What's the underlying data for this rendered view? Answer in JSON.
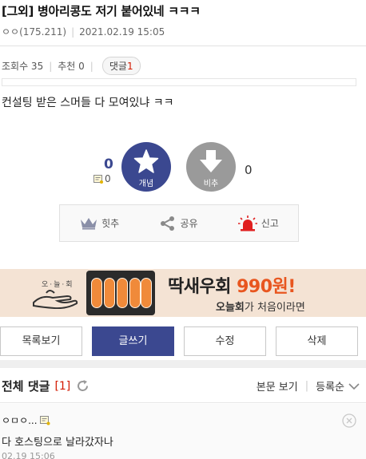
{
  "post": {
    "title": "[그외] 병아리콩도 저기 붙어있네 ㅋㅋㅋ",
    "author": "ㅇㅇ(175.211)",
    "date": "2021.02.19 15:05",
    "views_label": "조회수 35",
    "recommend_label": "추천 0",
    "comment_label": "댓글",
    "comment_count": "1",
    "body": "컨설팅 받은 스머들 다 모여있냐 ㅋㅋ"
  },
  "vote": {
    "up_count": "0",
    "up_label": "개념",
    "report_count": "0",
    "down_count": "0",
    "down_label": "비추",
    "up_color": "#3b4890",
    "down_color": "#9a9a9a"
  },
  "actions": [
    {
      "label": "힛추",
      "icon": "crown-icon"
    },
    {
      "label": "공유",
      "icon": "share-icon"
    },
    {
      "label": "신고",
      "icon": "siren-icon"
    }
  ],
  "banner": {
    "brand_small": "오·늘·회",
    "headline_prefix": "딱새우회 ",
    "headline_price": "990원!",
    "sub_brand": "오늘회",
    "sub_rest": "가 처음이라면",
    "price_color": "#e8561f"
  },
  "buttons": {
    "list": "목록보기",
    "write": "글쓰기",
    "edit": "수정",
    "delete": "삭제"
  },
  "comments": {
    "title": "전체 댓글",
    "count": "[1]",
    "view_body": "본문 보기",
    "sort": "등록순",
    "items": [
      {
        "author": "ㅇㅁㅇ...",
        "text": "다 호스팅으로 날라갔자나",
        "time": "02.19 15:06"
      }
    ]
  }
}
